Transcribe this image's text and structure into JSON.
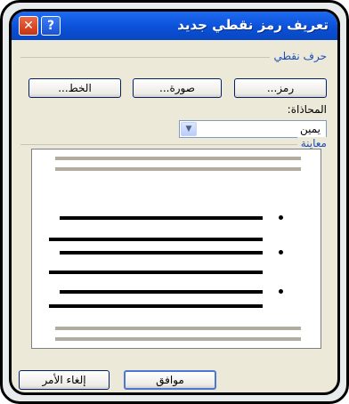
{
  "window": {
    "title": "تعريف رمز نقطي جديد",
    "help_icon": "?",
    "close_icon": "✕"
  },
  "bullet_character": {
    "group_label": "حرف نقطي",
    "symbol_button": "رمز...",
    "picture_button": "صورة...",
    "font_button": "الخط..."
  },
  "alignment": {
    "label": "المحاذاة:",
    "selected": "يمين"
  },
  "preview": {
    "group_label": "معاينة"
  },
  "footer": {
    "ok_button": "موافق",
    "cancel_button": "إلغاء الأمر"
  },
  "colors": {
    "title_bar": "#0a4fd6",
    "dialog_bg": "#ece9d8",
    "group_label": "#1e4fb8"
  }
}
